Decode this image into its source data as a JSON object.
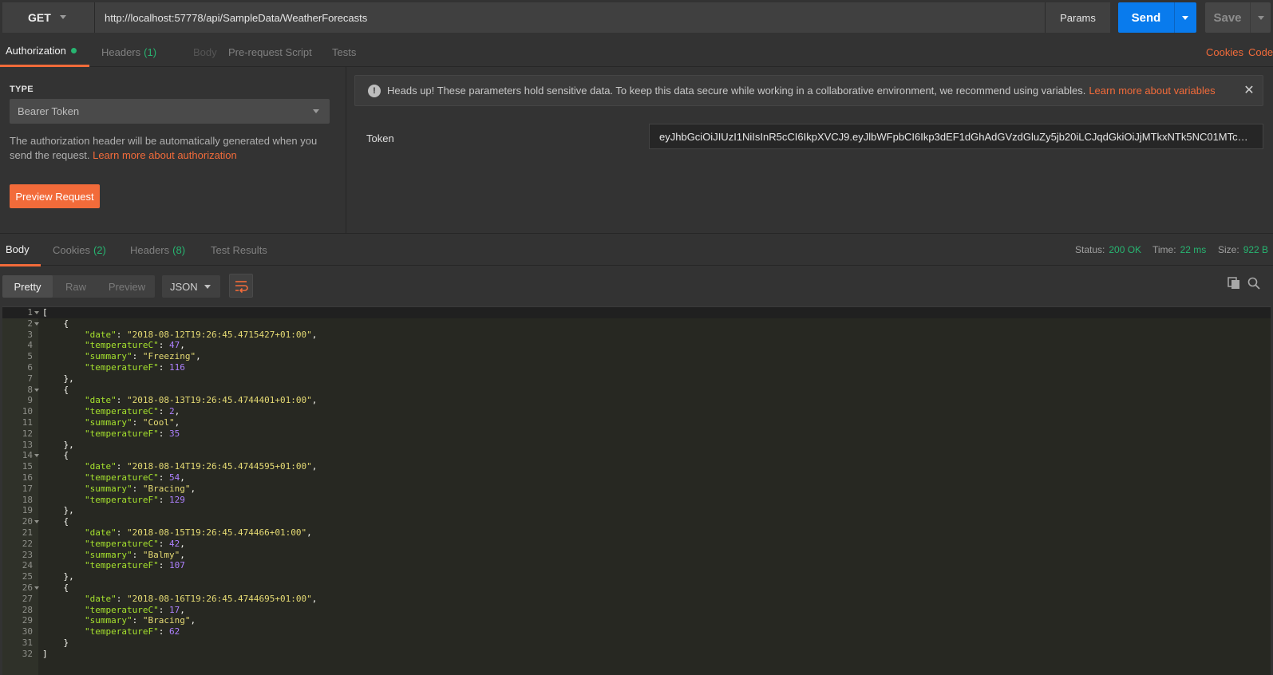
{
  "url_bar": {
    "method": "GET",
    "url": "http://localhost:57778/api/SampleData/WeatherForecasts",
    "params_label": "Params",
    "send_label": "Send",
    "save_label": "Save"
  },
  "request_tabs": [
    {
      "label": "Authorization",
      "count": "",
      "state": "active"
    },
    {
      "label": "Headers",
      "count": "(1)",
      "state": "normal"
    },
    {
      "label": "Body",
      "count": "",
      "state": "disabled"
    },
    {
      "label": "Pre-request Script",
      "count": "",
      "state": "normal"
    },
    {
      "label": "Tests",
      "count": "",
      "state": "normal"
    }
  ],
  "request_links": {
    "cookies": "Cookies",
    "code": "Code"
  },
  "auth": {
    "type_label": "TYPE",
    "type_value": "Bearer Token",
    "description": "The authorization header will be automatically generated when you send the request.",
    "learn_more": "Learn more about authorization",
    "preview_button": "Preview Request",
    "alert_text": "Heads up! These parameters hold sensitive data. To keep this data secure while working in a collaborative environment, we recommend using variables.",
    "alert_link": "Learn more about variables",
    "token_label": "Token",
    "token_value": "eyJhbGciOiJIUzI1NiIsInR5cCI6IkpXVCJ9.eyJlbWFpbCI6Ikp3dEF1dGhAdGVzdGluZy5jb20iLCJqdGkiOiJjMTkxNTk5NC01MTc0LTQ4MDMt..."
  },
  "response_tabs": [
    {
      "label": "Body",
      "count": "",
      "state": "active"
    },
    {
      "label": "Cookies",
      "count": "(2)",
      "state": "normal"
    },
    {
      "label": "Headers",
      "count": "(8)",
      "state": "normal"
    },
    {
      "label": "Test Results",
      "count": "",
      "state": "normal"
    }
  ],
  "response_status": {
    "status_label": "Status:",
    "status_value": "200 OK",
    "time_label": "Time:",
    "time_value": "22 ms",
    "size_label": "Size:",
    "size_value": "922 B"
  },
  "response_views": [
    "Pretty",
    "Raw",
    "Preview"
  ],
  "response_format": "JSON",
  "icons": {
    "wrap": "wrap-lines-icon",
    "copy": "copy-icon",
    "search": "search-icon",
    "alert": "exclamation-circle-icon",
    "close": "close-icon"
  },
  "colors": {
    "accent": "#f26b3a",
    "send": "#097bed",
    "success": "#27b571"
  },
  "forecasts": [
    {
      "date": "2018-08-12T19:26:45.4715427+01:00",
      "temperatureC": 47,
      "summary": "Freezing",
      "temperatureF": 116
    },
    {
      "date": "2018-08-13T19:26:45.4744401+01:00",
      "temperatureC": 2,
      "summary": "Cool",
      "temperatureF": 35
    },
    {
      "date": "2018-08-14T19:26:45.4744595+01:00",
      "temperatureC": 54,
      "summary": "Bracing",
      "temperatureF": 129
    },
    {
      "date": "2018-08-15T19:26:45.474466+01:00",
      "temperatureC": 42,
      "summary": "Balmy",
      "temperatureF": 107
    },
    {
      "date": "2018-08-16T19:26:45.4744695+01:00",
      "temperatureC": 17,
      "summary": "Bracing",
      "temperatureF": 62
    }
  ]
}
